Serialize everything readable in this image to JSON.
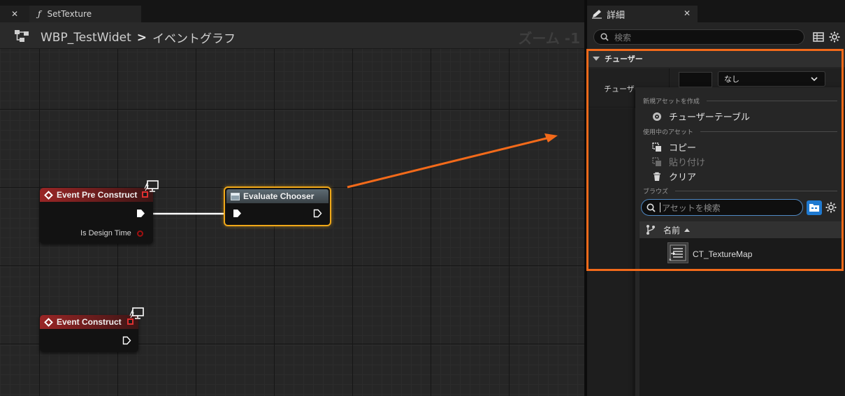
{
  "tabs": {
    "close_glyph": "✕",
    "main_icon": "ƒ",
    "main_label": "SetTexture"
  },
  "graph": {
    "breadcrumb_root": "WBP_TestWidet",
    "breadcrumb_sep": ">",
    "breadcrumb_leaf": "イベントグラフ",
    "zoom": "ズーム -1"
  },
  "nodes": {
    "event_pre_construct": {
      "title": "Event Pre Construct",
      "pin_label": "Is Design Time"
    },
    "evaluate_chooser": {
      "title": "Evaluate Chooser"
    },
    "event_construct": {
      "title": "Event Construct"
    }
  },
  "details": {
    "tab_label": "詳細",
    "tab_close": "✕",
    "search_placeholder": "検索",
    "category": "チューザー",
    "property_label": "チューザー",
    "combo_value": "なし"
  },
  "menu": {
    "section_create": "新規アセットを作成",
    "item_chooser_table": "チューザーテーブル",
    "section_in_use": "使用中のアセット",
    "item_copy": "コピー",
    "item_paste": "貼り付け",
    "item_clear": "クリア",
    "section_browse": "ブラウズ",
    "asset_search_placeholder": "アセットを検索",
    "column_name": "名前",
    "assets": [
      {
        "name": "CT_TextureMap"
      }
    ]
  },
  "colors": {
    "highlight": "#f36a1a",
    "selected_node_border": "#f0a818",
    "event_header": "#9a2626",
    "accent_blue": "#1f7ad1"
  }
}
